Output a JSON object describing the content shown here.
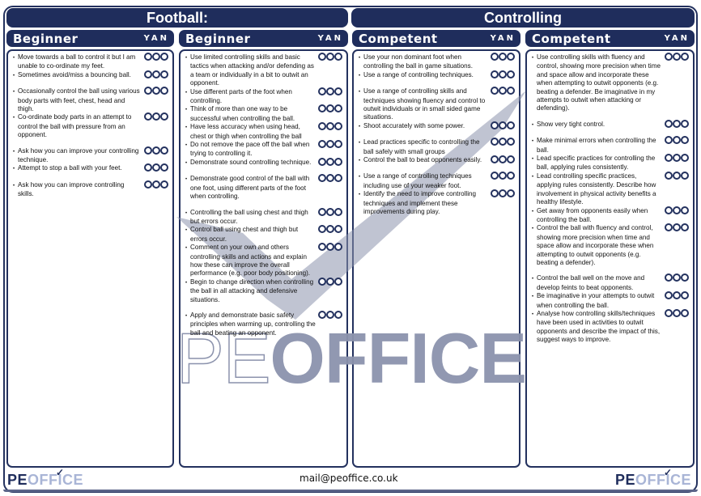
{
  "titles": {
    "left": "Football:",
    "right": "Controlling"
  },
  "rating_header": "YAN",
  "rating_options": [
    "Y",
    "A",
    "N"
  ],
  "columns": [
    {
      "level": "Beginner",
      "items": [
        {
          "text": "Move towards a ball to control it but I am unable to co-ordinate my feet.",
          "gap": "none"
        },
        {
          "text": "Sometimes avoid/miss a bouncing ball.",
          "gap": "none"
        },
        {
          "text": "Occasionally control the ball using various body parts with feet, chest, head and thigh.",
          "gap": "gap"
        },
        {
          "text": "Co-ordinate body parts in an attempt to control the ball with pressure from an opponent.",
          "gap": "none"
        },
        {
          "text": "Ask how you can improve your controlling technique.",
          "gap": "gap"
        },
        {
          "text": "Attempt to stop a ball with your feet.",
          "gap": "none"
        },
        {
          "text": "Ask how you can improve controlling skills.",
          "gap": "gap"
        }
      ]
    },
    {
      "level": "Beginner",
      "items": [
        {
          "text": "Use limited controlling skills and basic tactics when attacking and/or defending as a team or individually in a bit to outwit an opponent.",
          "gap": "none"
        },
        {
          "text": "Use different parts of the foot when controlling.",
          "gap": "none"
        },
        {
          "text": "Think of more than one way to be successful when controlling the ball.",
          "gap": "none"
        },
        {
          "text": "Have less accuracy when using head, chest or thigh when controlling the ball",
          "gap": "none"
        },
        {
          "text": "Do not remove the pace off the ball when trying to controlling it.",
          "gap": "none"
        },
        {
          "text": "Demonstrate sound controlling technique.",
          "gap": "none"
        },
        {
          "text": "Demonstrate good control of the ball with one foot, using different parts of the foot when controlling.",
          "gap": "gap"
        },
        {
          "text": "Controlling the ball using chest and thigh but errors occur.",
          "gap": "gap"
        },
        {
          "text": "Control ball using chest and thigh but errors occur.",
          "gap": "none"
        },
        {
          "text": "Comment on your own and others controlling skills and actions and explain how these can improve the overall performance (e.g. poor body positioning).",
          "gap": "none"
        },
        {
          "text": "Begin to change direction when controlling the ball in all attacking and defensive situations.",
          "gap": "none"
        },
        {
          "text": "Apply and demonstrate basic safety principles when warming up, controlling the ball and beating an opponent.",
          "gap": "gap"
        }
      ]
    },
    {
      "level": "Competent",
      "items": [
        {
          "text": "Use your non dominant foot when controlling the ball in game situations.",
          "gap": "none"
        },
        {
          "text": "Use a range of controlling techniques.",
          "gap": "none"
        },
        {
          "text": "Use a range of controlling skills and techniques showing fluency and control to outwit individuals or in small sided game situations.",
          "gap": "gap"
        },
        {
          "text": "Shoot accurately with some power.",
          "gap": "none"
        },
        {
          "text": "Lead practices specific to controlling the ball safely with small groups",
          "gap": "gap"
        },
        {
          "text": "Control the ball to beat opponents easily.",
          "gap": "none"
        },
        {
          "text": "Use a range of controlling techniques including use of your weaker foot.",
          "gap": "gap"
        },
        {
          "text": "Identify the need to improve controlling techniques and implement these improvements during play.",
          "gap": "none"
        }
      ]
    },
    {
      "level": "Competent",
      "items": [
        {
          "text": "Use controlling skills with fluency and control, showing more precision when time and space allow and incorporate these when attempting to outwit opponents (e.g. beating a defender. Be imaginative in my attempts to outwit when attacking or defending).",
          "gap": "none"
        },
        {
          "text": "Show very tight control.",
          "gap": "gap"
        },
        {
          "text": "Make minimal errors when controlling the ball.",
          "gap": "gap"
        },
        {
          "text": "Lead specific practices for controlling the ball, applying rules consistently.",
          "gap": "none"
        },
        {
          "text": "Lead controlling specific practices, applying rules consistently. Describe how involvement in physical activity benefits a healthy lifestyle.",
          "gap": "none"
        },
        {
          "text": "Get away from opponents easily when controlling the ball.",
          "gap": "none"
        },
        {
          "text": "Control the ball with fluency and control, showing more precision when time and space allow and incorporate these when attempting to outwit opponents (e.g. beating a defender).",
          "gap": "none"
        },
        {
          "text": "Control the ball well on the move and develop feints to beat opponents.",
          "gap": "gap"
        },
        {
          "text": "Be imaginative in your attempts to outwit when controlling the ball.",
          "gap": "none"
        },
        {
          "text": "Analyse how controlling skills/techniques have been used in activities to outwit opponents and describe the impact of this, suggest ways to improve.",
          "gap": "none"
        }
      ]
    }
  ],
  "watermark": {
    "pe": "PE",
    "office": "OFFICE"
  },
  "footer": {
    "logo_pe": "PE",
    "logo_office": "OFFICE",
    "email": "mail@peoffice.co.uk"
  },
  "colors": {
    "navy": "#1f2d5c",
    "watermark": "#8c93ad",
    "logo_light": "#a9b5d6"
  }
}
